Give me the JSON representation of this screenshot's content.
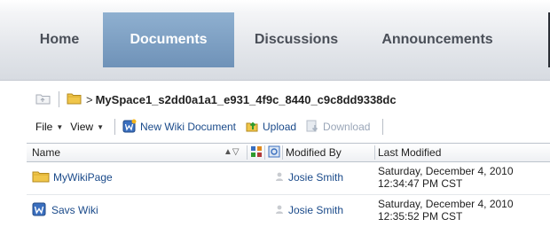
{
  "tabs": [
    "Home",
    "Documents",
    "Discussions",
    "Announcements"
  ],
  "breadcrumb": {
    "separator": ">",
    "path": "MySpace1_s2dd0a1a1_e931_4f9c_8440_c9c8dd9338dc"
  },
  "toolbar": {
    "file_label": "File",
    "view_label": "View",
    "new_wiki_label": "New Wiki Document",
    "upload_label": "Upload",
    "download_label": "Download"
  },
  "table": {
    "columns": {
      "name": "Name",
      "modified_by": "Modified By",
      "last_modified": "Last Modified"
    },
    "rows": [
      {
        "name": "MyWikiPage",
        "type": "folder",
        "modified_by": "Josie Smith",
        "modified_date": "Saturday, December 4, 2010",
        "modified_time": "12:34:47 PM CST"
      },
      {
        "name": "Savs Wiki",
        "type": "wiki",
        "modified_by": "Josie Smith",
        "modified_date": "Saturday, December 4, 2010",
        "modified_time": "12:35:52 PM CST"
      }
    ]
  },
  "colors": {
    "active_tab": "#7c9dc2",
    "link": "#1a4a8a",
    "folder": "#f0c64a"
  }
}
